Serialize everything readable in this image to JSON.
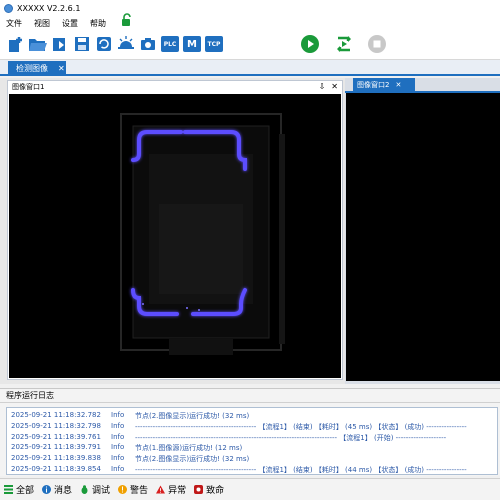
{
  "window": {
    "title": "XXXXX V2.2.6.1"
  },
  "menu": {
    "items": [
      "文件",
      "视图",
      "设置",
      "帮助"
    ]
  },
  "toolbar": {
    "plc_label": "PLC",
    "m_label": "M",
    "tcp_label": "TCP"
  },
  "tabs": {
    "main_tab": "检测图像",
    "close_glyph": "✕"
  },
  "pane1": {
    "title": "图像窗口1",
    "pin_glyph": "⇩",
    "close_glyph": "✕"
  },
  "pane2": {
    "title": "图像窗口2",
    "close_glyph": "✕"
  },
  "log": {
    "title": "程序运行日志",
    "rows": [
      {
        "time": "2025-09-21 11:18:32.782",
        "level": "Info",
        "msg": "节点(2.图像显示)运行成功! (32 ms)"
      },
      {
        "time": "2025-09-21 11:18:32.798",
        "level": "Info",
        "msg": "------------------------------------------------ 【流程1】 (结束) 【耗时】 (45 ms) 【状态】 (成功) ----------------"
      },
      {
        "time": "2025-09-21 11:18:39.761",
        "level": "Info",
        "msg": "-------------------------------------------------------------------------------- 【流程1】 (开始) --------------------"
      },
      {
        "time": "2025-09-21 11:18:39.791",
        "level": "Info",
        "msg": "节点(1.图像源)运行成功! (12 ms)"
      },
      {
        "time": "2025-09-21 11:18:39.838",
        "level": "Info",
        "msg": "节点(2.图像显示)运行成功! (32 ms)"
      },
      {
        "time": "2025-09-21 11:18:39.854",
        "level": "Info",
        "msg": "------------------------------------------------ 【流程1】 (结束) 【耗时】 (44 ms) 【状态】 (成功) ----------------"
      }
    ]
  },
  "filters": [
    {
      "label": "全部",
      "icon": "list-icon"
    },
    {
      "label": "消息",
      "icon": "info-icon"
    },
    {
      "label": "调试",
      "icon": "bug-icon"
    },
    {
      "label": "警告",
      "icon": "warning-circle-icon"
    },
    {
      "label": "异常",
      "icon": "error-triangle-icon"
    },
    {
      "label": "致命",
      "icon": "fatal-icon"
    }
  ],
  "colors": {
    "accent": "#1f6fbf",
    "run": "#1a9a3a",
    "log_text": "#2d5aa8",
    "glow": "#5a4cff"
  }
}
